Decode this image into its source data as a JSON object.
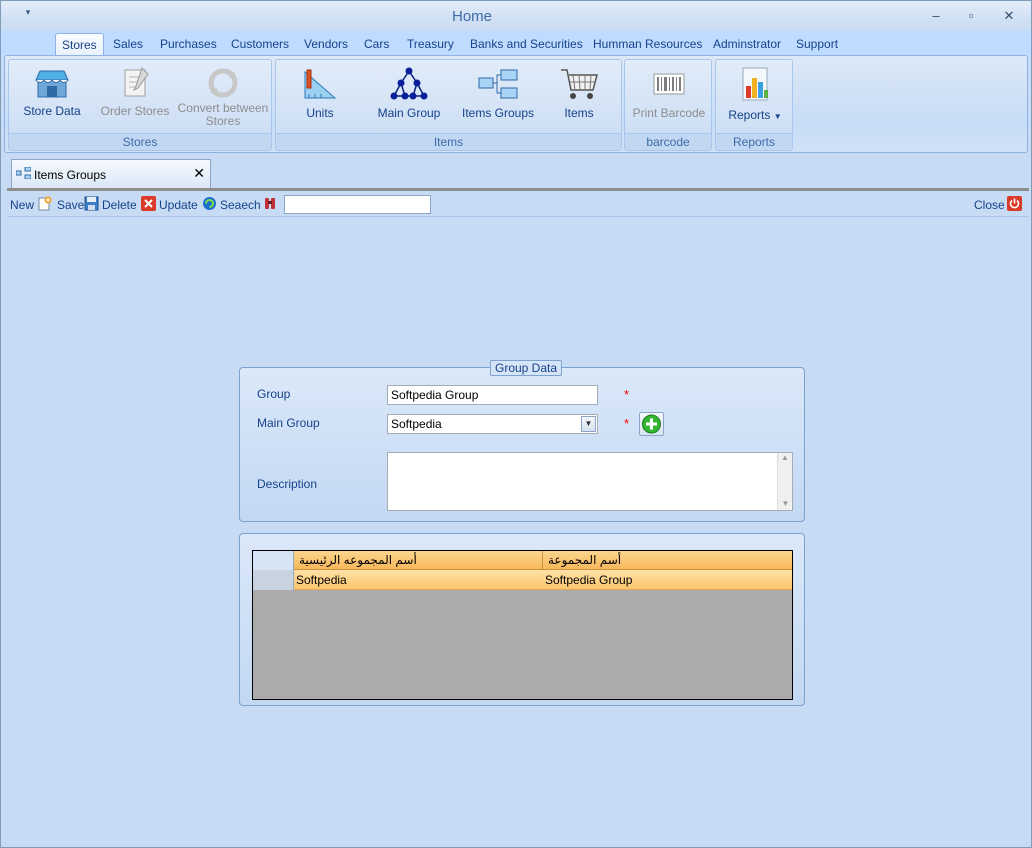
{
  "window": {
    "title": "Home"
  },
  "ribbon": {
    "tabs": [
      "Stores",
      "Sales",
      "Purchases",
      "Customers",
      "Vendors",
      "Cars",
      "Treasury",
      "Banks and Securities",
      "Humman Resources",
      "Adminstrator",
      "Support"
    ],
    "active_tab": "Stores",
    "groups": {
      "stores": {
        "label": "Stores",
        "buttons": [
          "Store Data",
          "Order Stores",
          "Convert between",
          "Stores"
        ]
      },
      "items": {
        "label": "Items",
        "buttons": [
          "Units",
          "Main Group",
          "Items Groups",
          "Items"
        ]
      },
      "barcode": {
        "label": "barcode",
        "buttons": [
          "Print Barcode"
        ]
      },
      "reports": {
        "label": "Reports",
        "buttons": [
          "Reports"
        ]
      }
    }
  },
  "doc_tab": {
    "title": "Items Groups"
  },
  "toolbar": {
    "new": "New",
    "save": "Save",
    "delete": "Delete",
    "update": "Update",
    "search": "Seaech",
    "close": "Close",
    "search_value": ""
  },
  "form": {
    "legend": "Group Data",
    "group_label": "Group",
    "group_value": "Softpedia Group",
    "main_group_label": "Main Group",
    "main_group_value": "Softpedia",
    "description_label": "Description",
    "description_value": "",
    "required_mark": "*"
  },
  "grid": {
    "columns": [
      "أسم المجموعه الرئيسية",
      "أسم المجموعة"
    ],
    "rows": [
      {
        "main_group": "Softpedia",
        "group": "Softpedia Group"
      }
    ]
  },
  "colors": {
    "ribbon_text": "#15428b",
    "row_highlight": "#fbc56e",
    "required": "#ff0000"
  }
}
